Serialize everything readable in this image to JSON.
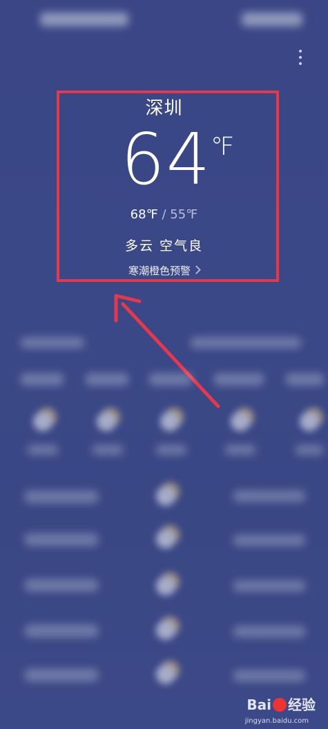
{
  "weather": {
    "city": "深圳",
    "temp": "64",
    "temp_unit": "℉",
    "high": "68℉",
    "separator": "/",
    "low": "55℉",
    "condition": "多云",
    "air_quality": "空气良",
    "alert": "寒潮橙色预警"
  },
  "watermark": {
    "brand": "Bai",
    "brand_suffix": "经验",
    "url": "jingyan.baidu.com"
  },
  "colors": {
    "background": "#3a4686",
    "highlight": "#e5384a"
  }
}
